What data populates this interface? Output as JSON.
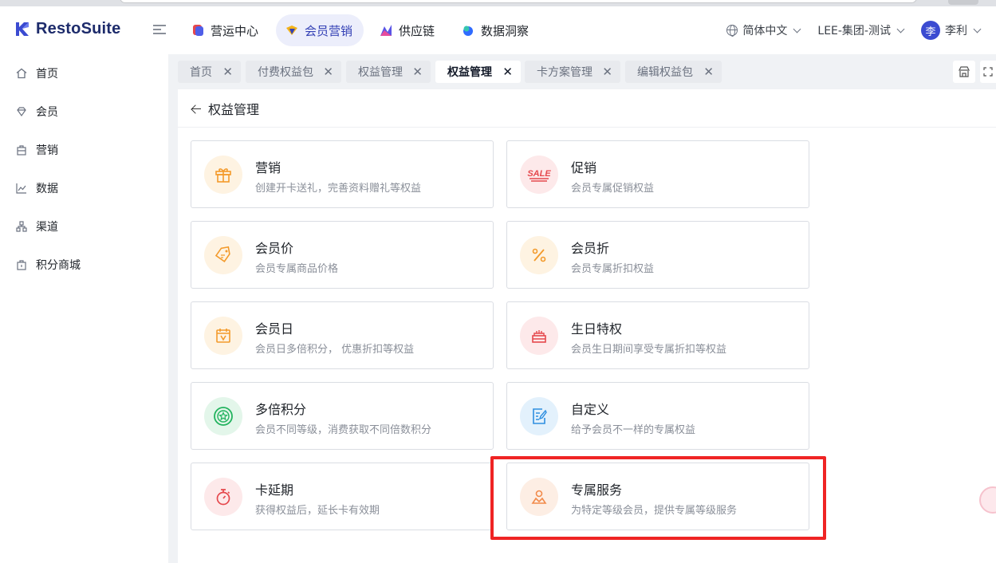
{
  "app": {
    "name": "RestoSuite"
  },
  "nav": [
    {
      "label": "营运中心",
      "icon": "operations-icon",
      "color": "#4f5ee8"
    },
    {
      "label": "会员营销",
      "icon": "member-marketing-icon",
      "color": "#3340b5"
    },
    {
      "label": "供应链",
      "icon": "supply-chain-icon",
      "color": "#5a55e6"
    },
    {
      "label": "数据洞察",
      "icon": "data-insight-icon",
      "color": "#2f6bff"
    }
  ],
  "header": {
    "language": "简体中文",
    "organization": "LEE-集团-测试",
    "user_avatar": "李",
    "user_name": "李利"
  },
  "sidebar": {
    "items": [
      {
        "label": "首页",
        "icon": "home-icon"
      },
      {
        "label": "会员",
        "icon": "diamond-icon"
      },
      {
        "label": "营销",
        "icon": "bag-icon"
      },
      {
        "label": "数据",
        "icon": "chart-icon"
      },
      {
        "label": "渠道",
        "icon": "channel-icon"
      },
      {
        "label": "积分商城",
        "icon": "shop-icon"
      }
    ]
  },
  "tabs": [
    {
      "label": "首页"
    },
    {
      "label": "付费权益包"
    },
    {
      "label": "权益管理"
    },
    {
      "label": "权益管理",
      "active": true
    },
    {
      "label": "卡方案管理"
    },
    {
      "label": "编辑权益包"
    }
  ],
  "page": {
    "title": "权益管理"
  },
  "cards": [
    {
      "title": "营销",
      "desc": "创建开卡送礼，完善资料赠礼等权益",
      "icon": "gift-icon"
    },
    {
      "title": "促销",
      "desc": "会员专属促销权益",
      "icon": "sale-icon",
      "icon_text": "SALE"
    },
    {
      "title": "会员价",
      "desc": "会员专属商品价格",
      "icon": "price-tag-icon"
    },
    {
      "title": "会员折",
      "desc": "会员专属折扣权益",
      "icon": "percent-icon",
      "icon_text": "%"
    },
    {
      "title": "会员日",
      "desc": "会员日多倍积分， 优惠折扣等权益",
      "icon": "calendar-icon"
    },
    {
      "title": "生日特权",
      "desc": "会员生日期间享受专属折扣等权益",
      "icon": "birthday-cake-icon"
    },
    {
      "title": "多倍积分",
      "desc": "会员不同等级，消费获取不同倍数积分",
      "icon": "star-medal-icon"
    },
    {
      "title": "自定义",
      "desc": "给予会员不一样的专属权益",
      "icon": "custom-form-icon"
    },
    {
      "title": "卡延期",
      "desc": "获得权益后，延长卡有效期",
      "icon": "stopwatch-icon"
    },
    {
      "title": "专属服务",
      "desc": "为特定等级会员，提供专属等级服务",
      "icon": "exclusive-service-icon"
    }
  ],
  "colors": {
    "accent": "#3340b5",
    "highlight": "#ef2424",
    "orange_icon": "#f39a2b",
    "red_icon": "#e5484d",
    "green_icon": "#22b35e",
    "blue_icon": "#2f8fe0"
  }
}
